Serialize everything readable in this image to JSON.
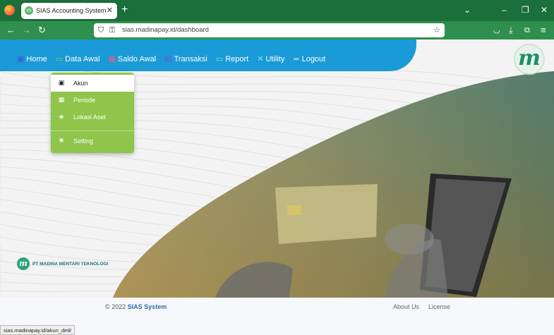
{
  "browser": {
    "tab_title": "SIAS Accounting System",
    "tab_close": "✕",
    "new_tab": "+",
    "url": "sias.madinapay.id/dashboard",
    "status_url": "sias.madinapay.id/akun_detil"
  },
  "menu": {
    "items": [
      {
        "label": "Home",
        "icon": "home-icon",
        "glyph": "▣",
        "color": "#3b5bdb"
      },
      {
        "label": "Data Awal",
        "icon": "monitor-icon",
        "glyph": "▭",
        "color": "#8ec54a"
      },
      {
        "label": "Saldo Awal",
        "icon": "money-icon",
        "glyph": "▦",
        "color": "#e85c8a"
      },
      {
        "label": "Transaksi",
        "icon": "transaction-icon",
        "glyph": "▤",
        "color": "#6a5acd"
      },
      {
        "label": "Report",
        "icon": "report-icon",
        "glyph": "▭",
        "color": "#7fe3f0"
      },
      {
        "label": "Utility",
        "icon": "tools-icon",
        "glyph": "✕",
        "color": "#7fe3f0"
      },
      {
        "label": "Logout",
        "icon": "logout-icon",
        "glyph": "➦",
        "color": "#9fc4e8"
      }
    ]
  },
  "dropdown": {
    "items": [
      {
        "label": "Akun",
        "icon": "id-card-icon",
        "glyph": "▣",
        "active": true
      },
      {
        "label": "Periode",
        "icon": "calendar-icon",
        "glyph": "▦",
        "active": false
      },
      {
        "label": "Lokasi Aset",
        "icon": "box-icon",
        "glyph": "◈",
        "active": false
      },
      {
        "label": "Setting",
        "icon": "gear-icon",
        "glyph": "✹",
        "active": false
      }
    ]
  },
  "brand": {
    "logo_letter": "m",
    "company": "PT MADINA MENTARI TEKNOLOGI"
  },
  "footer": {
    "copyright": "© 2022",
    "system_name": "SIAS System",
    "about": "About Us",
    "license": "License"
  },
  "colors": {
    "topbar": "#1a9ad6",
    "dropdown": "#8ec54a",
    "browser_green": "#1b6f3a"
  }
}
